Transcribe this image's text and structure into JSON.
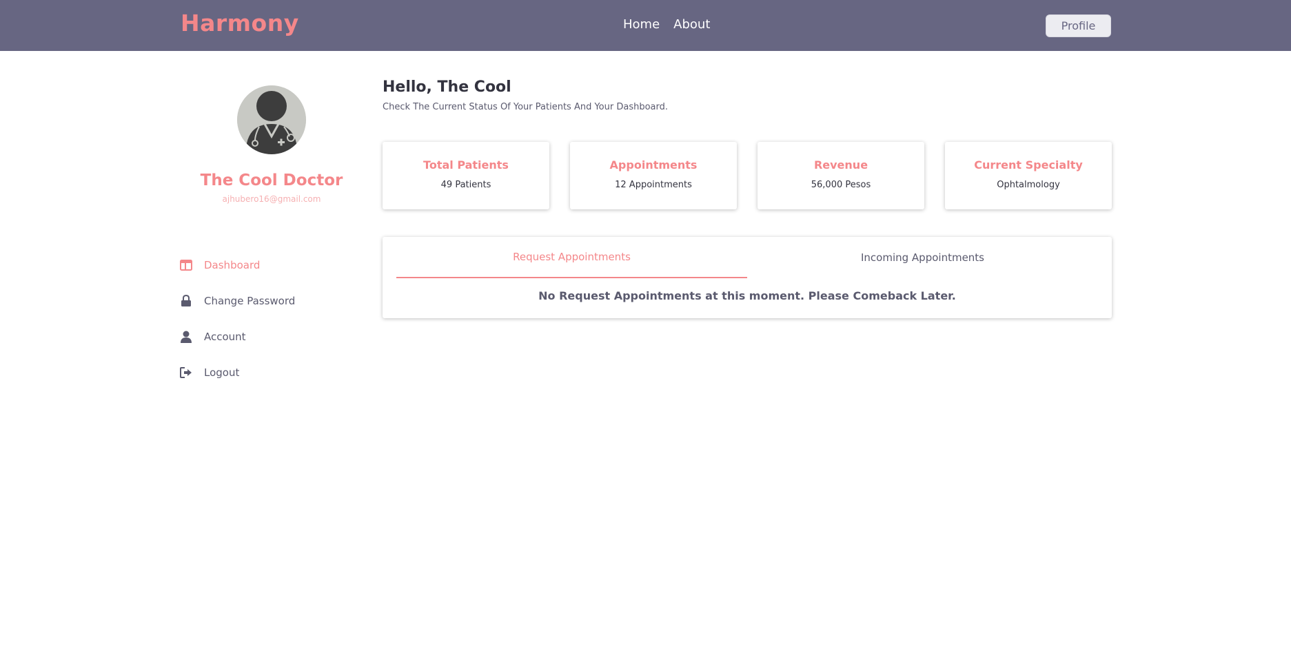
{
  "navbar": {
    "brand": "Harmony",
    "links": [
      "Home",
      "About"
    ],
    "profile_button": "Profile"
  },
  "sidebar": {
    "avatar_icon": "doctor-avatar-icon",
    "name": "The Cool Doctor",
    "email": "ajhubero16@gmail.com",
    "menu": [
      {
        "label": "Dashboard",
        "icon": "dashboard-icon",
        "active": true
      },
      {
        "label": "Change Password",
        "icon": "lock-icon",
        "active": false
      },
      {
        "label": "Account",
        "icon": "user-icon",
        "active": false
      },
      {
        "label": "Logout",
        "icon": "logout-icon",
        "active": false
      }
    ]
  },
  "main": {
    "greeting": "Hello, The Cool",
    "subtitle": "Check The Current Status Of Your Patients And Your Dashboard.",
    "stats": [
      {
        "title": "Total Patients",
        "value": "49 Patients"
      },
      {
        "title": "Appointments",
        "value": "12 Appointments"
      },
      {
        "title": "Revenue",
        "value": "56,000 Pesos"
      },
      {
        "title": "Current Specialty",
        "value": "Ophtalmology"
      }
    ],
    "tabs": [
      {
        "label": "Request Appointments",
        "active": true
      },
      {
        "label": "Incoming Appointments",
        "active": false
      }
    ],
    "empty_message": "No Request Appointments at this moment. Please Comeback Later."
  },
  "colors": {
    "navbar_bg": "#676682",
    "accent": "#f4878a",
    "text_dark": "#33333f",
    "text_muted": "#5a5a6e"
  }
}
